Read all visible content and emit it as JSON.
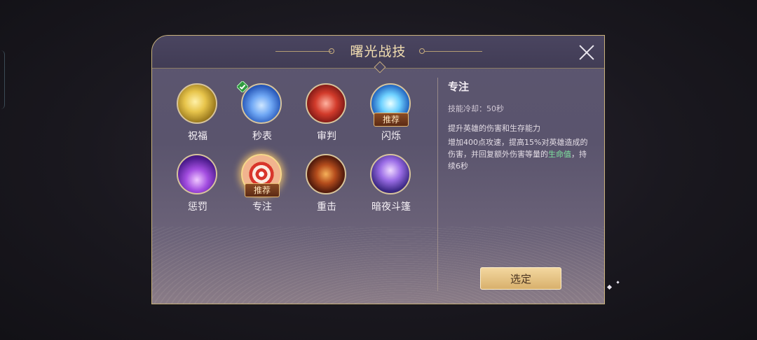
{
  "dialog": {
    "title": "曙光战技"
  },
  "skills": [
    {
      "label": "祝福",
      "icon": "blessing-icon",
      "equipped": false,
      "recommended": false
    },
    {
      "label": "秒表",
      "icon": "stopwatch-icon",
      "equipped": true,
      "recommended": false
    },
    {
      "label": "审判",
      "icon": "judgment-icon",
      "equipped": false,
      "recommended": false
    },
    {
      "label": "闪烁",
      "icon": "flash-icon",
      "equipped": false,
      "recommended": true
    },
    {
      "label": "惩罚",
      "icon": "punish-icon",
      "equipped": false,
      "recommended": false
    },
    {
      "label": "专注",
      "icon": "focus-icon",
      "equipped": false,
      "recommended": true,
      "selected": true
    },
    {
      "label": "重击",
      "icon": "smash-icon",
      "equipped": false,
      "recommended": false
    },
    {
      "label": "暗夜斗篷",
      "icon": "night-cloak-icon",
      "equipped": false,
      "recommended": false
    }
  ],
  "badges": {
    "recommended": "推荐"
  },
  "detail": {
    "name": "专注",
    "cooldown": "技能冷却：50秒",
    "summary": "提升英雄的伤害和生存能力",
    "desc_main": "增加400点攻速，提高15%对英雄造成的伤害，并回复额外伤害等量的",
    "desc_highlight": "生命值",
    "desc_tail": "，持续6秒"
  },
  "confirm": {
    "label": "选定"
  },
  "colors": {
    "accent_gold": "#c9b27c",
    "highlight_green": "#7ee39f",
    "equipped_check": "#3bbf4e"
  }
}
